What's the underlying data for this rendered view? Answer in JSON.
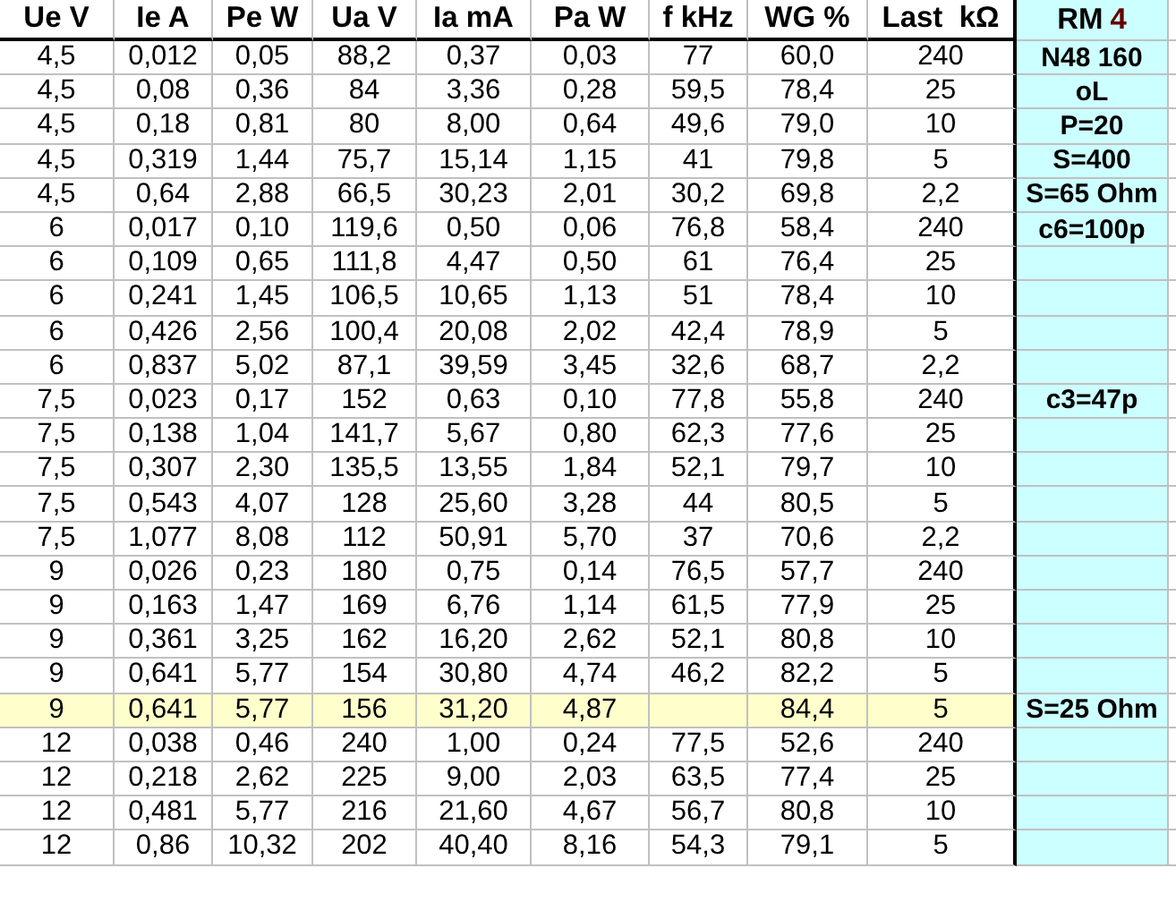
{
  "columns": [
    "Ue V",
    "Ie A",
    "Pe W",
    "Ua V",
    "Ia mA",
    "Pa W",
    "f kHz",
    "WG %",
    "Last  kΩ"
  ],
  "side_header": {
    "label": "RM",
    "accent": "4"
  },
  "rows": [
    {
      "cells": [
        "4,5",
        "0,012",
        "0,05",
        "88,2",
        "0,37",
        "0,03",
        "77",
        "60,0",
        "240"
      ],
      "highlighted": false,
      "note": "N48 160"
    },
    {
      "cells": [
        "4,5",
        "0,08",
        "0,36",
        "84",
        "3,36",
        "0,28",
        "59,5",
        "78,4",
        "25"
      ],
      "highlighted": false,
      "note": "oL"
    },
    {
      "cells": [
        "4,5",
        "0,18",
        "0,81",
        "80",
        "8,00",
        "0,64",
        "49,6",
        "79,0",
        "10"
      ],
      "highlighted": false,
      "note": "P=20"
    },
    {
      "cells": [
        "4,5",
        "0,319",
        "1,44",
        "75,7",
        "15,14",
        "1,15",
        "41",
        "79,8",
        "5"
      ],
      "highlighted": false,
      "note": "S=400"
    },
    {
      "cells": [
        "4,5",
        "0,64",
        "2,88",
        "66,5",
        "30,23",
        "2,01",
        "30,2",
        "69,8",
        "2,2"
      ],
      "highlighted": false,
      "note": "S=65 Ohm"
    },
    {
      "cells": [
        "6",
        "0,017",
        "0,10",
        "119,6",
        "0,50",
        "0,06",
        "76,8",
        "58,4",
        "240"
      ],
      "highlighted": false,
      "note": "c6=100p"
    },
    {
      "cells": [
        "6",
        "0,109",
        "0,65",
        "111,8",
        "4,47",
        "0,50",
        "61",
        "76,4",
        "25"
      ],
      "highlighted": false
    },
    {
      "cells": [
        "6",
        "0,241",
        "1,45",
        "106,5",
        "10,65",
        "1,13",
        "51",
        "78,4",
        "10"
      ],
      "highlighted": false
    },
    {
      "cells": [
        "6",
        "0,426",
        "2,56",
        "100,4",
        "20,08",
        "2,02",
        "42,4",
        "78,9",
        "5"
      ],
      "highlighted": false
    },
    {
      "cells": [
        "6",
        "0,837",
        "5,02",
        "87,1",
        "39,59",
        "3,45",
        "32,6",
        "68,7",
        "2,2"
      ],
      "highlighted": false
    },
    {
      "cells": [
        "7,5",
        "0,023",
        "0,17",
        "152",
        "0,63",
        "0,10",
        "77,8",
        "55,8",
        "240"
      ],
      "highlighted": false,
      "note": "c3=47p"
    },
    {
      "cells": [
        "7,5",
        "0,138",
        "1,04",
        "141,7",
        "5,67",
        "0,80",
        "62,3",
        "77,6",
        "25"
      ],
      "highlighted": false
    },
    {
      "cells": [
        "7,5",
        "0,307",
        "2,30",
        "135,5",
        "13,55",
        "1,84",
        "52,1",
        "79,7",
        "10"
      ],
      "highlighted": false
    },
    {
      "cells": [
        "7,5",
        "0,543",
        "4,07",
        "128",
        "25,60",
        "3,28",
        "44",
        "80,5",
        "5"
      ],
      "highlighted": false
    },
    {
      "cells": [
        "7,5",
        "1,077",
        "8,08",
        "112",
        "50,91",
        "5,70",
        "37",
        "70,6",
        "2,2"
      ],
      "highlighted": false
    },
    {
      "cells": [
        "9",
        "0,026",
        "0,23",
        "180",
        "0,75",
        "0,14",
        "76,5",
        "57,7",
        "240"
      ],
      "highlighted": false
    },
    {
      "cells": [
        "9",
        "0,163",
        "1,47",
        "169",
        "6,76",
        "1,14",
        "61,5",
        "77,9",
        "25"
      ],
      "highlighted": false
    },
    {
      "cells": [
        "9",
        "0,361",
        "3,25",
        "162",
        "16,20",
        "2,62",
        "52,1",
        "80,8",
        "10"
      ],
      "highlighted": false
    },
    {
      "cells": [
        "9",
        "0,641",
        "5,77",
        "154",
        "30,80",
        "4,74",
        "46,2",
        "82,2",
        "5"
      ],
      "highlighted": false
    },
    {
      "cells": [
        "9",
        "0,641",
        "5,77",
        "156",
        "31,20",
        "4,87",
        null,
        "84,4",
        "5"
      ],
      "highlighted": true,
      "note": "S=25 Ohm"
    },
    {
      "cells": [
        "12",
        "0,038",
        "0,46",
        "240",
        "1,00",
        "0,24",
        "77,5",
        "52,6",
        "240"
      ],
      "highlighted": false
    },
    {
      "cells": [
        "12",
        "0,218",
        "2,62",
        "225",
        "9,00",
        "2,03",
        "63,5",
        "77,4",
        "25"
      ],
      "highlighted": false
    },
    {
      "cells": [
        "12",
        "0,481",
        "5,77",
        "216",
        "21,60",
        "4,67",
        "56,7",
        "80,8",
        "10"
      ],
      "highlighted": false
    },
    {
      "cells": [
        "12",
        "0,86",
        "10,32",
        "202",
        "40,40",
        "8,16",
        "54,3",
        "79,1",
        "5"
      ],
      "highlighted": false
    }
  ]
}
